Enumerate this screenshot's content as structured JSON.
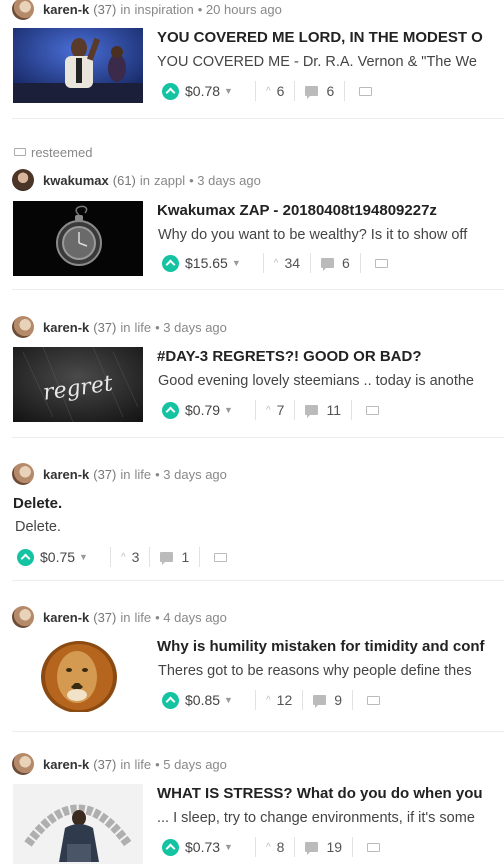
{
  "posts": [
    {
      "author": "karen-k",
      "rep": "(37)",
      "in": "in",
      "category": "inspiration",
      "time": "• 20 hours ago",
      "title": "YOU COVERED ME LORD, IN THE MODEST O",
      "body": "YOU COVERED ME - Dr. R.A. Vernon & \"The We",
      "payout": "$0.78",
      "votes": "6",
      "comments": "6",
      "thumbnail": "preacher-on-stage"
    },
    {
      "resteemed": "resteemed",
      "author": "kwakumax",
      "rep": "(61)",
      "in": "in",
      "category": "zappl",
      "time": "• 3 days ago",
      "title": "Kwakumax ZAP - 20180408t194809227z",
      "body": "Why do you want to be wealthy? Is it to show off",
      "payout": "$15.65",
      "votes": "34",
      "comments": "6",
      "thumbnail": "pocket-watch"
    },
    {
      "author": "karen-k",
      "rep": "(37)",
      "in": "in",
      "category": "life",
      "time": "• 3 days ago",
      "title": "#DAY-3 REGRETS?! GOOD OR BAD?",
      "body": "Good evening lovely steemians .. today is anothe",
      "payout": "$0.79",
      "votes": "7",
      "comments": "11",
      "thumbnail": "regret-chalkboard",
      "thumbnail_text": "regret"
    },
    {
      "author": "karen-k",
      "rep": "(37)",
      "in": "in",
      "category": "life",
      "time": "• 3 days ago",
      "title": "Delete.",
      "body": "Delete.",
      "payout": "$0.75",
      "votes": "3",
      "comments": "1"
    },
    {
      "author": "karen-k",
      "rep": "(37)",
      "in": "in",
      "category": "life",
      "time": "• 4 days ago",
      "title": "Why is humility mistaken for timidity and conf",
      "body": "Theres got to be reasons why people define thes",
      "payout": "$0.85",
      "votes": "12",
      "comments": "9",
      "thumbnail": "lion"
    },
    {
      "author": "karen-k",
      "rep": "(37)",
      "in": "in",
      "category": "life",
      "time": "• 5 days ago",
      "title": "WHAT IS STRESS? What do you do when you",
      "body": "... I sleep, try to change environments, if it's some",
      "payout": "$0.73",
      "votes": "8",
      "comments": "19",
      "thumbnail": "stress-man"
    }
  ],
  "colors": {
    "upvote": "#14c3a1",
    "divider": "#ececec"
  },
  "icons": [
    "upvote-icon",
    "caret-down-icon",
    "chevron-up-icon",
    "comment-icon",
    "resteem-icon"
  ]
}
